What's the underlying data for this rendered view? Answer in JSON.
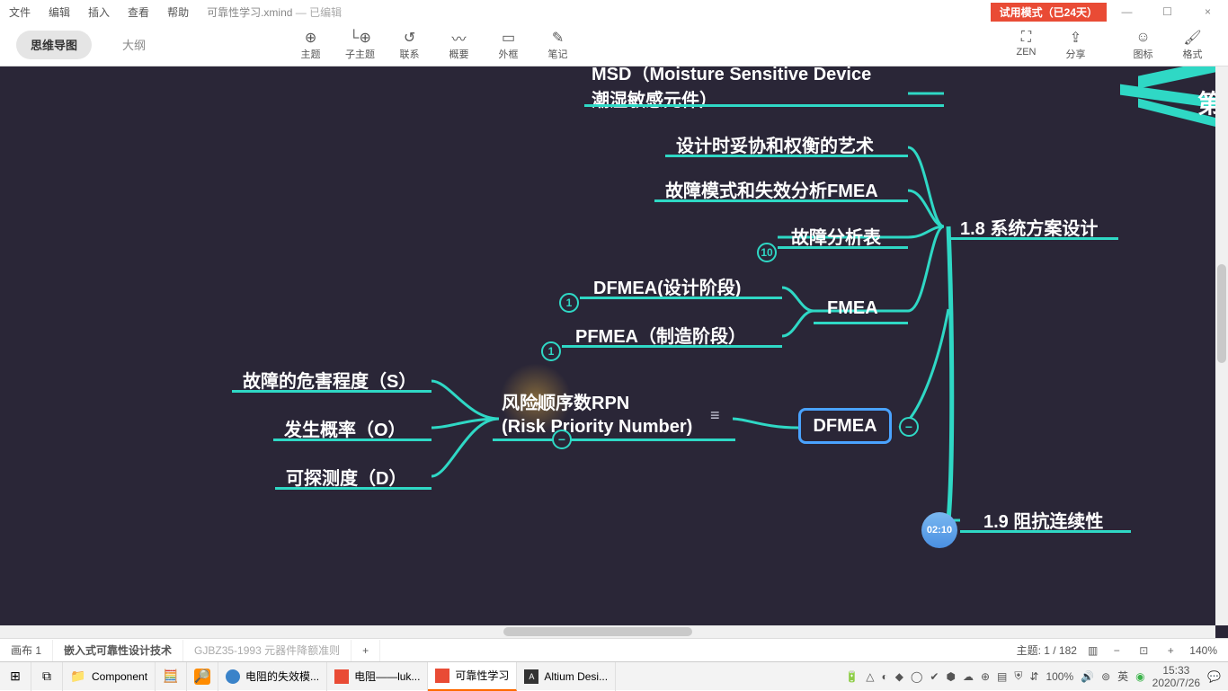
{
  "menu": {
    "file": "文件",
    "edit": "编辑",
    "insert": "插入",
    "view": "查看",
    "help": "帮助"
  },
  "filename": "可靠性学习.xmind",
  "file_state": "— 已编辑",
  "trial": "试用模式（已24天）",
  "win": {
    "min": "—",
    "max": "☐",
    "close": "×"
  },
  "view_tabs": {
    "mindmap": "思维导图",
    "outline": "大纲"
  },
  "tools": {
    "topic": "主题",
    "subtopic": "子主题",
    "relation": "联系",
    "summary": "概要",
    "boundary": "外框",
    "note": "笔记",
    "zen": "ZEN",
    "share": "分享",
    "icon": "图标",
    "format": "格式"
  },
  "tool_glyph": {
    "topic": "⊕",
    "subtopic": "└⊕",
    "relation": "↺",
    "summary": "〰",
    "boundary": "▭",
    "note": "✎",
    "zen": "⛶",
    "share": "⇪",
    "icon": "☺",
    "format": "🖌"
  },
  "nodes": {
    "msd_l1": "MSD（Moisture Sensitive Device",
    "msd_l2": "潮湿敏感元件）",
    "art": "设计时妥协和权衡的艺术",
    "fmea_fail": "故障模式和失效分析FMEA",
    "fault_table": "故障分析表",
    "sys18": "1.8 系统方案设计",
    "fmea": "FMEA",
    "dfmea_stage": "DFMEA(设计阶段)",
    "pfmea_stage": "PFMEA（制造阶段）",
    "dfmea": "DFMEA",
    "rpn_l1": "风险顺序数RPN",
    "rpn_l2": "(Risk Priority Number)",
    "s": "故障的危害程度（S）",
    "o": "发生概率（O）",
    "d": "可探测度（D）",
    "imp19": "1.9 阻抗连续性",
    "edge": "第"
  },
  "bullets": {
    "ten": "10",
    "one_a": "1",
    "one_b": "1"
  },
  "collapse_minus": "−",
  "time_bubble": "02:10",
  "notes_glyph": "≡",
  "cursor_glyph": "↖",
  "bottom_tabs": {
    "canvas": "画布 1",
    "sheet1": "嵌入式可靠性设计技术",
    "sheet2": "GJBZ35-1993 元器件降额准则",
    "add": "+"
  },
  "status": {
    "topics": "主题: 1 / 182",
    "map": "▥",
    "zoom_out": "−",
    "zoom_fit": "⊡",
    "zoom_in": "+",
    "zoom": "140%"
  },
  "taskbar": {
    "start": "⊞",
    "tasks": "⧉",
    "explorer": "📁",
    "explorer_label": "Component",
    "calc": "🧮",
    "everything": "🔎",
    "app1": "电阻的失效模...",
    "app2": "电阻——luk...",
    "app3": "可靠性学习",
    "app4": "Altium Desi...",
    "clock_time": "15:33",
    "clock_date": "2020/7/26",
    "ime": "英",
    "bat": "🔋",
    "zoom100": "100%"
  },
  "colors": {
    "accent": "#2fd8c5",
    "canvas": "#2a2637",
    "trial": "#e94b35"
  }
}
